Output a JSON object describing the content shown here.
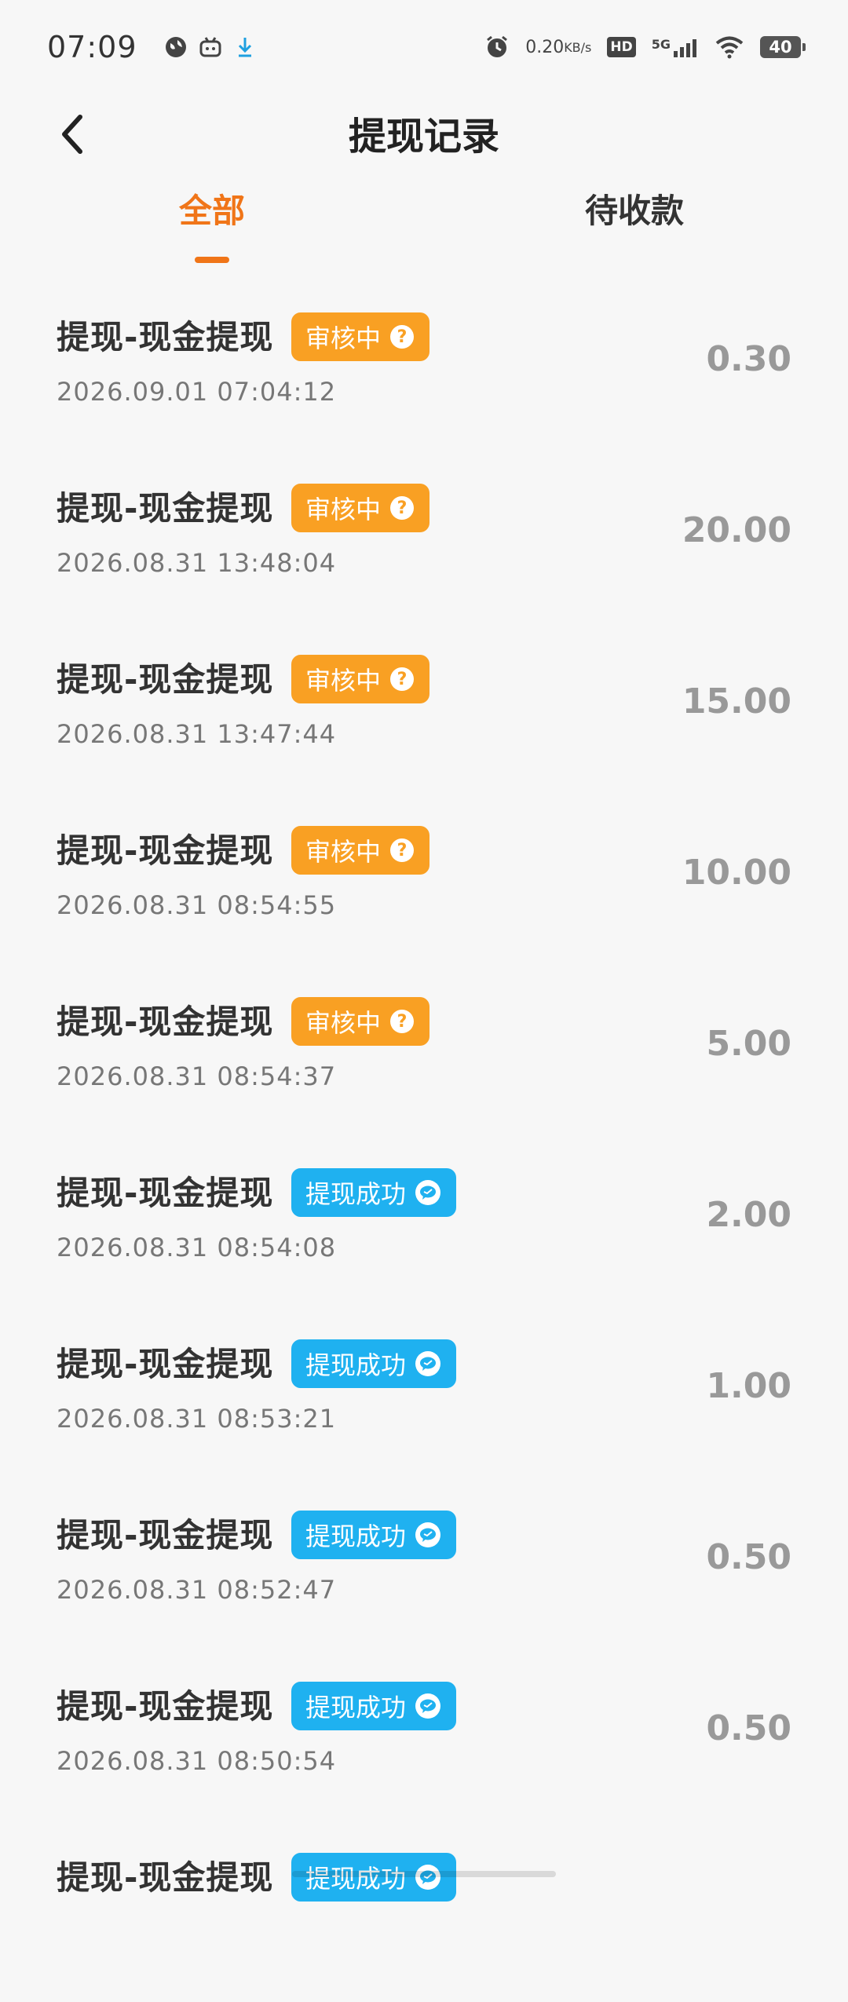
{
  "status_bar": {
    "time": "07:09",
    "net_speed_value": "0.20",
    "net_speed_unit": "KB/s",
    "hd_label": "HD",
    "signal_label": "5G",
    "battery": "40"
  },
  "header": {
    "title": "提现记录",
    "back_icon": "chevron-left-icon"
  },
  "tabs": [
    {
      "label": "全部",
      "active": true
    },
    {
      "label": "待收款",
      "active": false
    }
  ],
  "colors": {
    "accent": "#f07518",
    "pending_badge": "#f9a023",
    "success_badge": "#1fb1f0",
    "amount": "#999999"
  },
  "records": [
    {
      "title": "提现-现金提现",
      "status": "审核中",
      "status_type": "pending",
      "time": "2026.09.01 07:04:12",
      "amount": "0.30"
    },
    {
      "title": "提现-现金提现",
      "status": "审核中",
      "status_type": "pending",
      "time": "2026.08.31 13:48:04",
      "amount": "20.00"
    },
    {
      "title": "提现-现金提现",
      "status": "审核中",
      "status_type": "pending",
      "time": "2026.08.31 13:47:44",
      "amount": "15.00"
    },
    {
      "title": "提现-现金提现",
      "status": "审核中",
      "status_type": "pending",
      "time": "2026.08.31 08:54:55",
      "amount": "10.00"
    },
    {
      "title": "提现-现金提现",
      "status": "审核中",
      "status_type": "pending",
      "time": "2026.08.31 08:54:37",
      "amount": "5.00"
    },
    {
      "title": "提现-现金提现",
      "status": "提现成功",
      "status_type": "success",
      "time": "2026.08.31 08:54:08",
      "amount": "2.00"
    },
    {
      "title": "提现-现金提现",
      "status": "提现成功",
      "status_type": "success",
      "time": "2026.08.31 08:53:21",
      "amount": "1.00"
    },
    {
      "title": "提现-现金提现",
      "status": "提现成功",
      "status_type": "success",
      "time": "2026.08.31 08:52:47",
      "amount": "0.50"
    },
    {
      "title": "提现-现金提现",
      "status": "提现成功",
      "status_type": "success",
      "time": "2026.08.31 08:50:54",
      "amount": "0.50"
    },
    {
      "title": "提现-现金提现",
      "status": "提现成功",
      "status_type": "success",
      "time": "",
      "amount": ""
    }
  ]
}
